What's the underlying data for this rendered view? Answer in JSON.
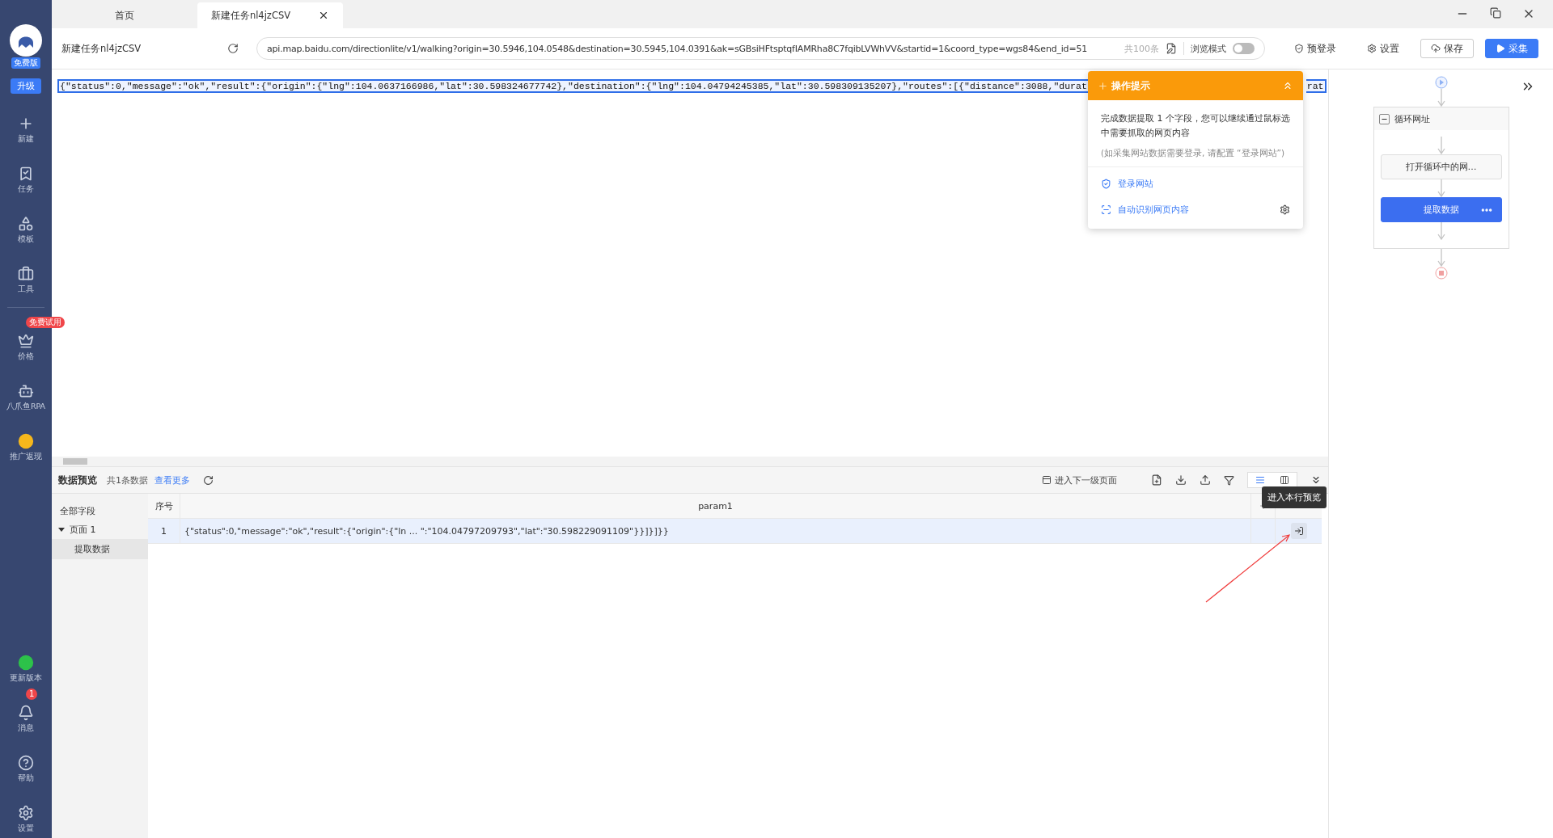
{
  "sidebar": {
    "logo_badge": "免费版",
    "upgrade": "升级",
    "top_items": [
      {
        "label": "新建",
        "kind": "new"
      },
      {
        "label": "任务",
        "kind": "task"
      },
      {
        "label": "模板",
        "kind": "template"
      },
      {
        "label": "工具",
        "kind": "tool"
      }
    ],
    "middle_items": [
      {
        "label": "价格",
        "kind": "price",
        "badge": "免费试用"
      },
      {
        "label": "八爪鱼RPA",
        "kind": "rpa"
      },
      {
        "label": "推广返现",
        "kind": "coin"
      }
    ],
    "bottom_items": [
      {
        "label": "更新版本",
        "kind": "update"
      },
      {
        "label": "消息",
        "kind": "bell",
        "badge": "1"
      },
      {
        "label": "帮助",
        "kind": "help"
      },
      {
        "label": "设置",
        "kind": "settings"
      }
    ]
  },
  "tabs": [
    {
      "label": "首页",
      "selected": false
    },
    {
      "label": "新建任务nl4jzCSV",
      "selected": true
    }
  ],
  "address_bar": {
    "task_name": "新建任务nl4jzCSV",
    "url": "api.map.baidu.com/directionlite/v1/walking?origin=30.5946,104.0548&destination=30.5945,104.0391&ak=sGBsiHFtsptqfIAMRha8C7fqibLVWhVV&startid=1&coord_type=wgs84&end_id=51",
    "count": "共100条",
    "browse_mode": {
      "label": "浏览模式",
      "on": false
    }
  },
  "actions": [
    {
      "label": "预登录",
      "kind": "shield"
    },
    {
      "label": "设置",
      "kind": "settings"
    },
    {
      "label": "保存",
      "kind": "save"
    },
    {
      "label": "采集",
      "kind": "run"
    }
  ],
  "page": {
    "json_line": "{\"status\":0,\"message\":\"ok\",\"result\":{\"origin\":{\"lng\":104.0637166986,\"lat\":30.598324677742},\"destination\":{\"lng\":104.04794245385,\"lat\":30.598309135207},\"routes\":[{\"distance\":3088,\"durat",
    "json_tail": "rat"
  },
  "tip_popup": {
    "title": "操作提示",
    "message": "完成数据提取 1 个字段，您可以继续通过鼠标选中需要抓取的网页内容",
    "note": "(如采集网站数据需要登录, 请配置 “登录网站”)",
    "links": [
      {
        "label": "登录网站",
        "kind": "shield"
      },
      {
        "label": "自动识别网页内容",
        "kind": "scan"
      }
    ]
  },
  "workflow": {
    "loop": "循环网址",
    "steps": [
      {
        "label": "打开循环中的网…",
        "selected": false
      },
      {
        "label": "提取数据",
        "selected": true
      }
    ]
  },
  "data_preview": {
    "title": "数据预览",
    "count": "共1条数据",
    "more": "查看更多",
    "next_page": "进入下一级页面",
    "view_modes": [
      {
        "kind": "list",
        "selected": true
      },
      {
        "kind": "columns",
        "selected": false
      }
    ],
    "tree": {
      "label": "全部字段",
      "selected": false,
      "children": [
        {
          "label": "页面 1",
          "selected": false,
          "expanded": true,
          "children": [
            {
              "label": "提取数据",
              "selected": true
            }
          ]
        }
      ]
    },
    "columns": [
      "序号",
      "param1"
    ],
    "rows": [
      {
        "selected": true,
        "cells": [
          "1",
          "{\"status\":0,\"message\":\"ok\",\"result\":{\"origin\":{\"ln ... \":\"104.04797209793\",\"lat\":\"30.598229091109\"}}]}]}}"
        ]
      }
    ],
    "tooltip": "进入本行预览"
  }
}
